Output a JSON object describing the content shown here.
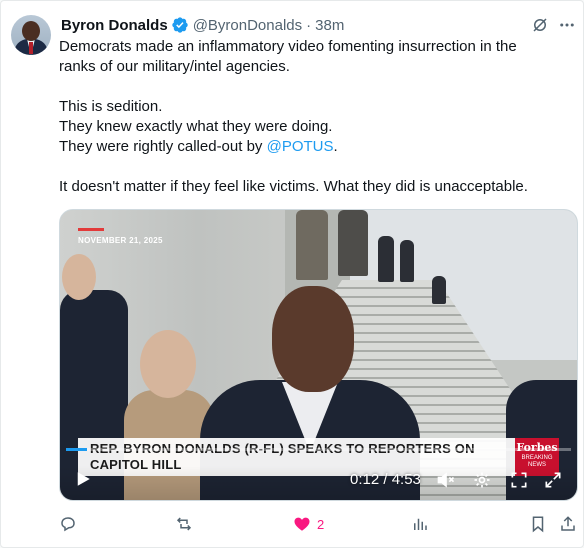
{
  "tweet": {
    "author_name": "Byron Donalds",
    "handle": "@ByronDonalds",
    "separator": "·",
    "time": "38m",
    "lines": {
      "l1": "Democrats made an inflammatory video fomenting insurrection in the",
      "l2": "ranks of our military/intel agencies.",
      "l3": "This is sedition.",
      "l4": "They knew exactly what they were doing.",
      "l5_prefix": "They were rightly called-out by ",
      "l5_mention": "@POTUS",
      "l5_suffix": ".",
      "l6": "It doesn't matter if they feel like victims. What they did is unacceptable."
    }
  },
  "video": {
    "date_overlay": "NOVEMBER 21, 2025",
    "lower_third_line1": "REP. BYRON DONALDS (R-FL) SPEAKS TO REPORTERS ON",
    "lower_third_line2": "CAPITOL HILL",
    "forbes_brand": "Forbes",
    "forbes_sub1": "BREAKING",
    "forbes_sub2": "NEWS",
    "time_readout": "0:12 / 4:53",
    "progress_fraction": 0.041
  },
  "actions": {
    "like_count": "2"
  },
  "colors": {
    "accent": "#1d9bf0",
    "like": "#f91880",
    "muted": "#536471",
    "forbes_red": "#c8102e"
  },
  "icons": [
    "verified-badge-icon",
    "grok-icon",
    "more-icon",
    "play-icon",
    "mute-icon",
    "settings-icon",
    "fullscreen-icon",
    "expand-icon",
    "reply-icon",
    "retweet-icon",
    "like-icon",
    "views-icon",
    "bookmark-icon",
    "share-icon"
  ]
}
